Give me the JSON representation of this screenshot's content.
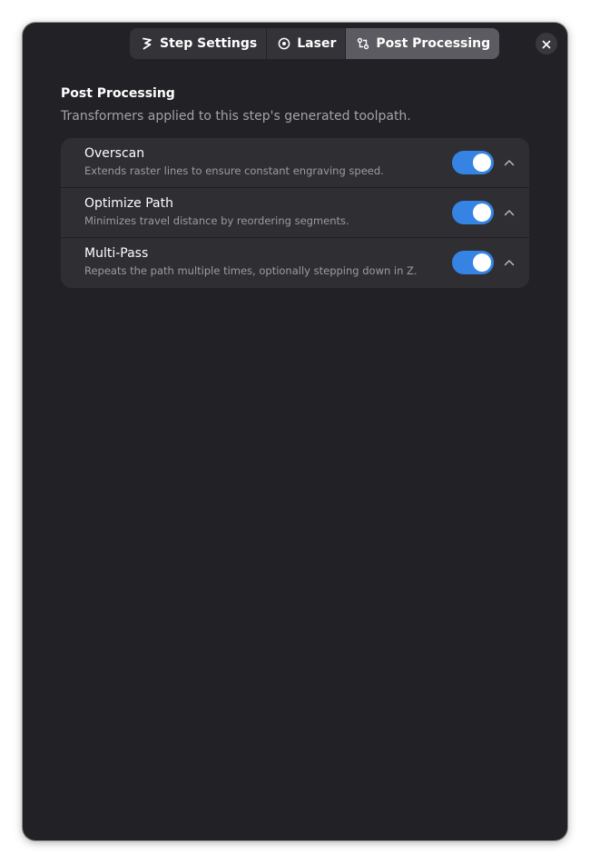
{
  "header": {
    "tabs": [
      {
        "label": "Step Settings",
        "icon": "steps-icon",
        "active": false
      },
      {
        "label": "Laser",
        "icon": "laser-target-icon",
        "active": false
      },
      {
        "label": "Post Processing",
        "icon": "transform-icon",
        "active": true
      }
    ],
    "close_icon": "close-icon"
  },
  "section": {
    "title": "Post Processing",
    "description": "Transformers applied to this step's generated toolpath."
  },
  "rows": [
    {
      "title": "Overscan",
      "subtitle": "Extends raster lines to ensure constant engraving speed.",
      "enabled": true,
      "expander_icon": "chevron-up-icon"
    },
    {
      "title": "Optimize Path",
      "subtitle": "Minimizes travel distance by reordering segments.",
      "enabled": true,
      "expander_icon": "chevron-up-icon"
    },
    {
      "title": "Multi-Pass",
      "subtitle": "Repeats the path multiple times, optionally stepping down in Z.",
      "enabled": true,
      "expander_icon": "chevron-up-icon"
    }
  ],
  "colors": {
    "accent": "#3584e4",
    "window_bg": "#222226",
    "card_bg": "#2e2e33",
    "text_primary": "#ffffff",
    "text_secondary": "#a4a4a8"
  }
}
